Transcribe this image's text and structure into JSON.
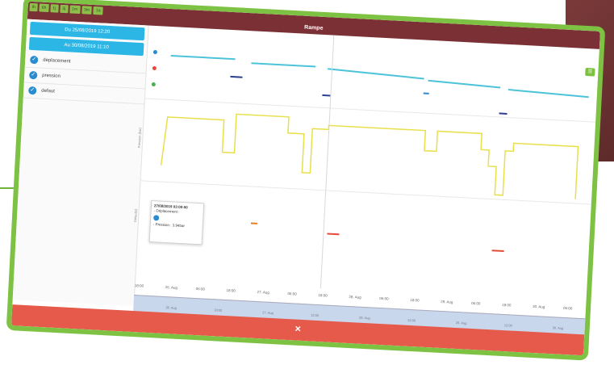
{
  "header": {
    "title": "Rampe",
    "tabs": [
      "Ih",
      "6h",
      "1j",
      "3j",
      "1m",
      "3m",
      "1a"
    ]
  },
  "sidebar": {
    "date_from": "Du 25/08/2019 12:20",
    "date_to": "Au 30/08/2019 11:10",
    "checks": [
      {
        "label": "deplacement",
        "checked": true
      },
      {
        "label": "pression",
        "checked": true
      },
      {
        "label": "defaut",
        "checked": true
      }
    ]
  },
  "charts": {
    "pressure_label": "Pression (bar)",
    "default_label": "Defaut(s)"
  },
  "tooltip": {
    "date": "27/08/2019 03:00:00",
    "line1": "- Déplacement :",
    "line2": "- Pression : 3.94bar"
  },
  "xaxis": {
    "ticks": [
      "18:00",
      "26. Aug",
      "06:00",
      "18:00",
      "27. Aug",
      "06:00",
      "18:00",
      "28. Aug",
      "06:00",
      "18:00",
      "29. Aug",
      "06:00",
      "18:00",
      "30. Aug",
      "06:00"
    ]
  },
  "navigator": {
    "ticks": [
      "26. Aug",
      "18:00",
      "27. Aug",
      "12:00",
      "28. Aug",
      "12:00",
      "29. Aug",
      "12:00",
      "30. Aug"
    ]
  },
  "bottombar": {
    "close_label": "✕"
  },
  "colors": {
    "frame": "#7ec243",
    "titlebar": "#7a3035",
    "date_button": "#2bb6e5",
    "pressure_line": "#e8e04a",
    "movement_line": "#4cc3d9",
    "default_marker": "#e64a3b",
    "bottombar": "#e55a4b"
  }
}
